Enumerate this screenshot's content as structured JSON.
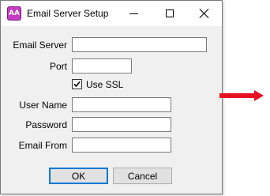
{
  "window": {
    "title": "Email Server Setup",
    "app_icon_text": "AA"
  },
  "titlebar": {
    "minimize_icon": "minimize-icon",
    "maximize_icon": "maximize-icon",
    "close_icon": "close-icon"
  },
  "form": {
    "email_server": {
      "label": "Email Server",
      "value": ""
    },
    "port": {
      "label": "Port",
      "value": ""
    },
    "use_ssl": {
      "label": "Use SSL",
      "checked": true
    },
    "user_name": {
      "label": "User Name",
      "value": ""
    },
    "password": {
      "label": "Password",
      "value": ""
    },
    "email_from": {
      "label": "Email From",
      "value": ""
    }
  },
  "buttons": {
    "ok": "OK",
    "cancel": "Cancel"
  },
  "annotation": {
    "arrow_color": "#e81123",
    "icon": "right-arrow-icon"
  }
}
